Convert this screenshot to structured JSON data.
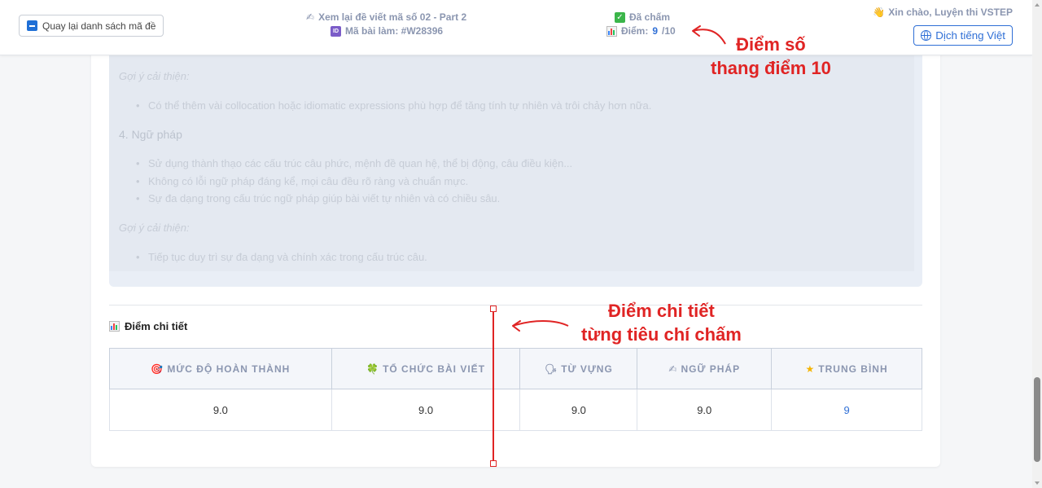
{
  "header": {
    "back_label": "Quay lại danh sách mã đề",
    "review_title": "Xem lại đề viết mã số 02 - Part 2",
    "submission_label": "Mã bài làm: #W28396",
    "status": "Đã chấm",
    "score_prefix": "Điểm:",
    "score_value": "9",
    "score_suffix": "/10",
    "greeting": "Xin chào, Luyện thi VSTEP",
    "translate_label": "Dịch tiếng Việt"
  },
  "feedback": {
    "suggestion_1_label": "Gợi ý cải thiện:",
    "suggestion_1_items": [
      "Có thể thêm vài collocation hoặc idiomatic expressions phù hợp để tăng tính tự nhiên và trôi chảy hơn nữa."
    ],
    "grammar_heading": "4. Ngữ pháp",
    "grammar_items": [
      "Sử dụng thành thạo các cấu trúc câu phức, mệnh đề quan hệ, thể bị động, câu điều kiện...",
      "Không có lỗi ngữ pháp đáng kể, mọi câu đều rõ ràng và chuẩn mực.",
      "Sự đa dạng trong cấu trúc ngữ pháp giúp bài viết tự nhiên và có chiều sâu."
    ],
    "suggestion_2_label": "Gợi ý cải thiện:",
    "suggestion_2_items": [
      "Tiếp tục duy trì sự đa dạng và chính xác trong cấu trúc câu."
    ]
  },
  "details": {
    "title": "Điểm chi tiết",
    "columns": [
      "MỨC ĐỘ HOÀN THÀNH",
      "TỔ CHỨC BÀI VIẾT",
      "TỪ VỰNG",
      "NGỮ PHÁP",
      "TRUNG BÌNH"
    ],
    "values": [
      "9.0",
      "9.0",
      "9.0",
      "9.0",
      "9"
    ]
  },
  "annotations": {
    "score_note_line1": "Điểm số",
    "score_note_line2": "thang điểm 10",
    "detail_note_line1": "Điểm chi tiết",
    "detail_note_line2": "từng tiêu chí chấm"
  },
  "colors": {
    "accent": "#2f6fd6",
    "annotation": "#e02424",
    "muted_header": "#8b96b0"
  },
  "icons": [
    "square-minus-icon",
    "writing-hand-icon",
    "id-icon",
    "check-icon",
    "bar-chart-icon",
    "wave-hand-icon",
    "globe-icon",
    "target-icon",
    "clover-icon",
    "speech-icon",
    "star-icon",
    "arrow-icon"
  ]
}
